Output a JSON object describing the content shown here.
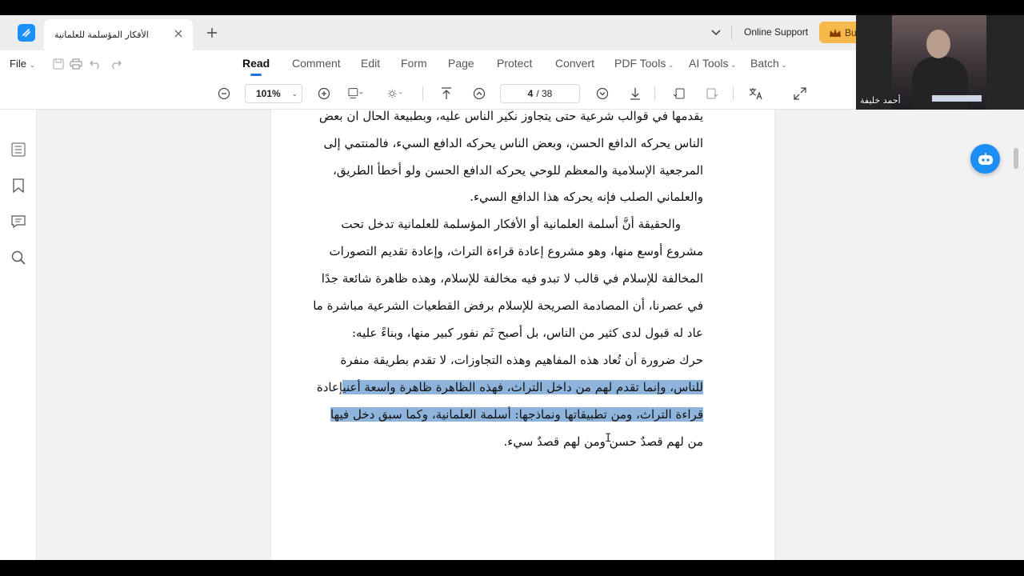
{
  "tab": {
    "title": "الأفكار المؤسلمة للعلمانية"
  },
  "titlebar": {
    "online_support": "Online Support",
    "buy_label": "Bu"
  },
  "menu": {
    "file": "File",
    "tabs": [
      "Read",
      "Comment",
      "Edit",
      "Form",
      "Page",
      "Protect",
      "Convert",
      "PDF Tools",
      "AI Tools",
      "Batch"
    ],
    "active_tab": "Read"
  },
  "toolbar": {
    "zoom": "101%",
    "page_current": "4",
    "page_total": "/ 38"
  },
  "document": {
    "lines": [
      {
        "text": "يقدمها في قوالب شرعية حتى يتجاوز نكير الناس عليه، وبطبيعة الحال ان بعض"
      },
      {
        "text": "الناس يحركه الدافع الحسن، وبعض الناس يحركه الدافع السيء، فالمنتمي إلى"
      },
      {
        "text": "المرجعية الإسلامية والمعظم للوحي يحركه الدافع الحسن ولو أخطأ الطريق،"
      },
      {
        "text": "والعلماني الصلب فإنه يحركه هذا الدافع السيء."
      },
      {
        "text": "والحقيقة أنَّ أسلمة العلمانية أو الأفكار المؤسلمة للعلمانية تدخل تحت"
      },
      {
        "text": "مشروع أوسع منها، وهو مشروع إعادة قراءة التراث، وإعادة تقديم التصورات"
      },
      {
        "text": "المخالفة للإسلام في قالب لا تبدو فيه مخالفة للإسلام، وهذه ظاهرة شائعة جدًا"
      },
      {
        "text": "في عصرنا، أن المصادمة الصريحة للإسلام برفض القطعيات الشرعية مباشرة ما"
      },
      {
        "text": "عاد له قبول لدى كثير من الناس، بل أصبح ثَم نفور كبير منها، وبناءً عليه:"
      },
      {
        "text": "حرك ضرورة أن تُعاد هذه المفاهيم وهذه التجاوزات، لا تقدم بطريقة منفرة"
      },
      {
        "pre": "إعادة ",
        "hl": "للناس، وإنما تقدم لهم من داخل التراث، فهذه الظاهرة ظاهرة واسعة أعني"
      },
      {
        "hl": "قراءة التراث، ومن تطبيقاتها ونماذجها: أسلمة العلمانية، وكما سبق دخل فيها"
      },
      {
        "text": "من لهم قصدٌ حسن ومن لهم قصدٌ سيء."
      }
    ]
  },
  "webcam": {
    "name": "أحمد خليفة"
  },
  "colors": {
    "accent": "#1d6ff2",
    "highlight": "#8fb4dc",
    "buy": "#f7b84b",
    "ai_button": "#1c8ef6"
  }
}
